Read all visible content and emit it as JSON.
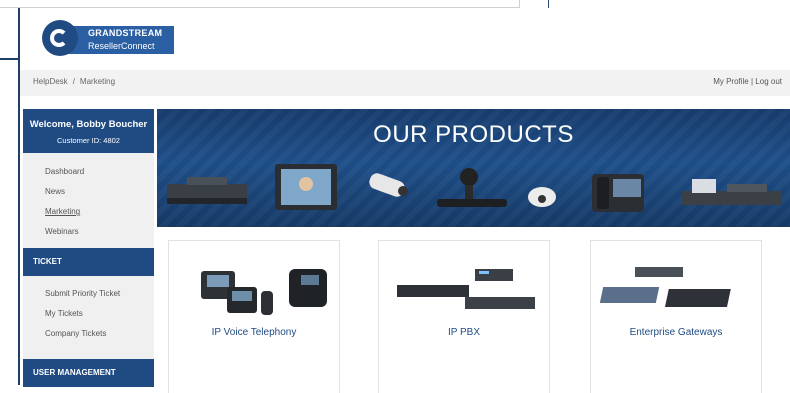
{
  "logo": {
    "brand": "GRANDSTREAM",
    "sub": "ResellerConnect"
  },
  "breadcrumb": {
    "items": [
      "HelpDesk",
      "Marketing"
    ],
    "separator": "/"
  },
  "user_links": {
    "profile": "My Profile",
    "separator": "|",
    "logout": "Log out"
  },
  "sidebar": {
    "welcome": "Welcome, Bobby Boucher",
    "customer_id": "Customer ID: 4802",
    "nav": [
      "Dashboard",
      "News",
      "Marketing",
      "Webinars"
    ],
    "active": "Marketing",
    "ticket_header": "TICKET",
    "ticket_items": [
      "Submit Priority Ticket",
      "My Tickets",
      "Company Tickets"
    ],
    "user_mgmt_header": "USER MANAGEMENT"
  },
  "banner": {
    "title": "OUR PRODUCTS"
  },
  "products": [
    {
      "label": "IP Voice Telephony"
    },
    {
      "label": "IP PBX"
    },
    {
      "label": "Enterprise Gateways"
    }
  ],
  "colors": {
    "brand": "#1f4b82",
    "sidebar_bg": "#f0f0f0",
    "crumbbar_bg": "#f2f2f2"
  }
}
